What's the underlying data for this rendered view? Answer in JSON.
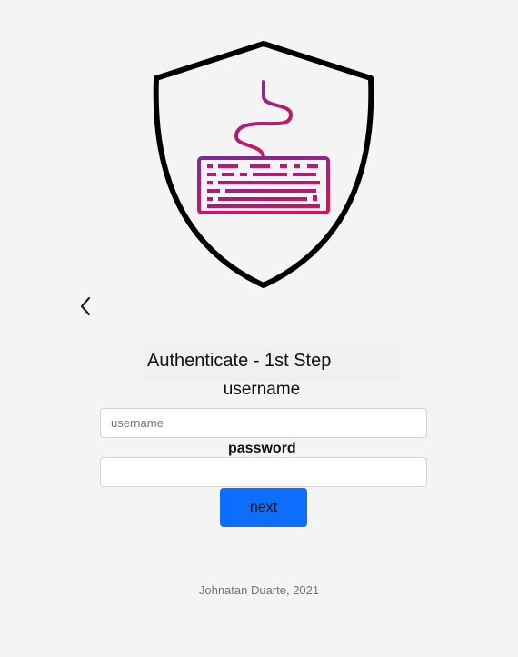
{
  "auth": {
    "title": "Authenticate - 1st Step",
    "username_label": "username",
    "username_placeholder": "username",
    "username_value": "",
    "password_label": "password",
    "password_value": "",
    "next_label": "next"
  },
  "footer": {
    "text": "Johnatan Duarte, 2021"
  },
  "icons": {
    "logo": "shield-keyboard-icon",
    "back": "chevron-left-icon"
  },
  "colors": {
    "background": "#f4f4f4",
    "primary_button": "#0d6efd",
    "keyboard_gradient_start": "#7a2a98",
    "keyboard_gradient_end": "#d4145a",
    "shield_stroke": "#000000"
  }
}
